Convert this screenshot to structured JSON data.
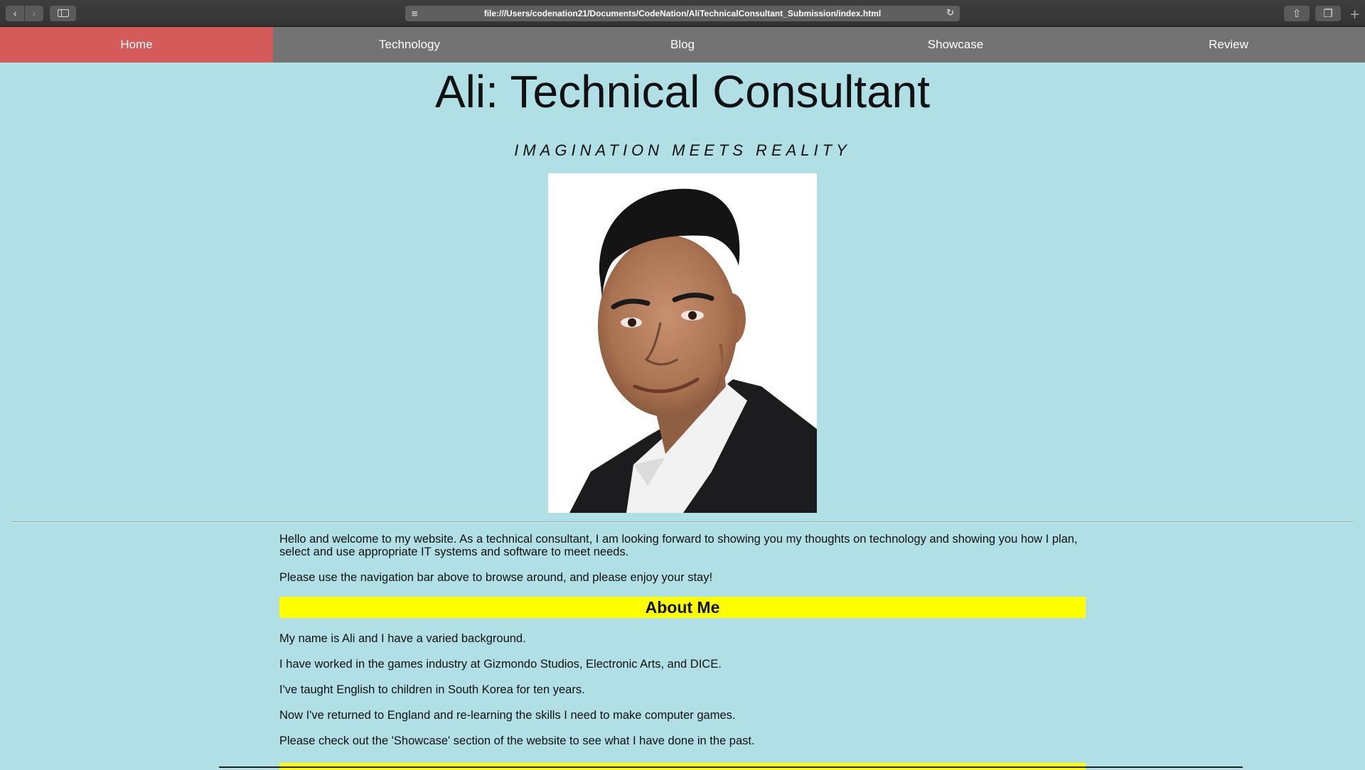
{
  "browser": {
    "url": "file:///Users/codenation21/Documents/CodeNation/AliTechnicalConsultant_Submission/index.html",
    "icons": [
      "back-icon",
      "forward-icon",
      "sidebar-icon",
      "reader-icon",
      "reload-icon",
      "share-icon",
      "tabs-icon",
      "new-tab-icon"
    ]
  },
  "nav": {
    "items": [
      {
        "label": "Home",
        "active": true
      },
      {
        "label": "Technology",
        "active": false
      },
      {
        "label": "Blog",
        "active": false
      },
      {
        "label": "Showcase",
        "active": false
      },
      {
        "label": "Review",
        "active": false
      }
    ],
    "active_color": "#d45b5a",
    "bar_color": "#737373"
  },
  "page": {
    "title": "Ali: Technical Consultant",
    "tagline": "IMAGINATION MEETS REALITY",
    "background": "#b0dfe5"
  },
  "intro": {
    "p1": "Hello and welcome to my website. As a technical consultant, I am looking forward to showing you my thoughts on technology and showing you how I plan, select and use appropriate IT systems and software to meet needs.",
    "p2": "Please use the navigation bar above to browse around, and please enjoy your stay!"
  },
  "about": {
    "heading": "About Me",
    "heading_color": "#ffff00",
    "paragraphs": [
      "My name is Ali and I have a varied background.",
      "I have worked in the games industry at Gizmondo Studios, Electronic Arts, and DICE.",
      "I've taught English to children in South Korea for ten years.",
      "Now I've returned to England and re-learning the skills I need to make computer games.",
      "Please check out the 'Showcase' section of the website to see what I have done in the past."
    ]
  }
}
